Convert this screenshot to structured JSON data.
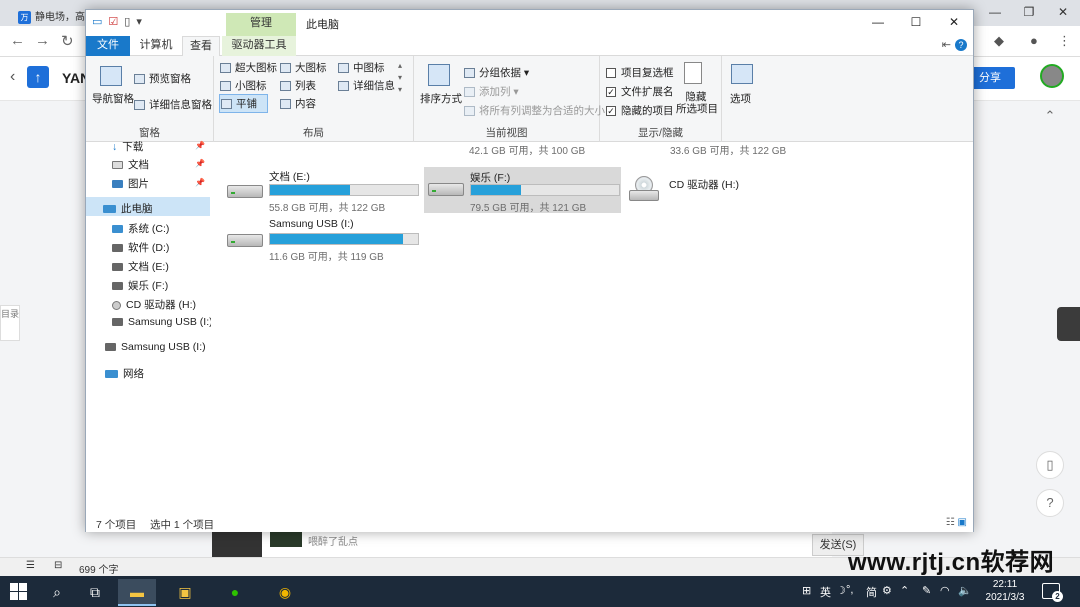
{
  "browser": {
    "tab1_title": "静电场，高",
    "site_brand": "YAN",
    "share_label": "分享",
    "side_tab": "目录",
    "chat_text": "喂醉了乱点",
    "send_label": "发送(S)",
    "word_count": "699 个字",
    "watermark": "www.rjtj.cn软荐网"
  },
  "window": {
    "title": "此电脑",
    "manage_tab": "管理",
    "tabs": {
      "file": "文件",
      "computer": "计算机",
      "view": "查看",
      "drive_tools": "驱动器工具"
    },
    "controls": {
      "minimize": "—",
      "maximize": "☐",
      "close": "✕"
    }
  },
  "ribbon": {
    "pane": {
      "nav_pane": "导航窗格",
      "preview_pane": "预览窗格",
      "details_pane": "详细信息窗格",
      "label": "窗格"
    },
    "layout": {
      "items": [
        "超大图标",
        "大图标",
        "中图标",
        "小图标",
        "列表",
        "详细信息",
        "平铺",
        "内容"
      ],
      "label": "布局"
    },
    "current_view": {
      "sort_by": "排序方式",
      "group_by": "分组依据",
      "add_columns": "添加列",
      "size_columns": "将所有列调整为合适的大小",
      "label": "当前视图"
    },
    "show_hide": {
      "item_checkboxes": "项目复选框",
      "file_extensions": "文件扩展名",
      "hidden_items": "隐藏的项目",
      "hide_selected_1": "隐藏",
      "hide_selected_2": "所选项目",
      "label": "显示/隐藏"
    },
    "options": "选项"
  },
  "nav": {
    "items": [
      {
        "label": "下载"
      },
      {
        "label": "文档"
      },
      {
        "label": "图片"
      },
      {
        "label": "此电脑"
      },
      {
        "label": "系统 (C:)"
      },
      {
        "label": "软件 (D:)"
      },
      {
        "label": "文档 (E:)"
      },
      {
        "label": "娱乐 (F:)"
      },
      {
        "label": "CD 驱动器 (H:)"
      },
      {
        "label": "Samsung USB (I:)"
      },
      {
        "label": "Samsung USB (I:)"
      },
      {
        "label": "网络"
      }
    ]
  },
  "drives": {
    "top_partial": [
      {
        "info": "42.1 GB 可用，共 100 GB"
      },
      {
        "info": "33.6 GB 可用，共 122 GB"
      }
    ],
    "e": {
      "name": "文档 (E:)",
      "info": "55.8 GB 可用，共 122 GB",
      "used_fraction": 0.54
    },
    "f": {
      "name": "娱乐 (F:)",
      "info": "79.5 GB 可用，共 121 GB",
      "used_fraction": 0.34
    },
    "h": {
      "name": "CD 驱动器 (H:)"
    },
    "i": {
      "name": "Samsung USB (I:)",
      "info": "11.6 GB 可用，共 119 GB",
      "used_fraction": 0.9
    }
  },
  "status": {
    "count": "7 个项目",
    "selected": "选中 1 个项目"
  },
  "taskbar": {
    "ime": "英",
    "simplified": "简",
    "time": "22:11",
    "date": "2021/3/3",
    "notifications": "2"
  },
  "colors": {
    "accent": "#1979ca",
    "bar_fill": "#26a0da",
    "manage_tab": "#cfe8b6",
    "taskbar": "#1c2a3a"
  }
}
